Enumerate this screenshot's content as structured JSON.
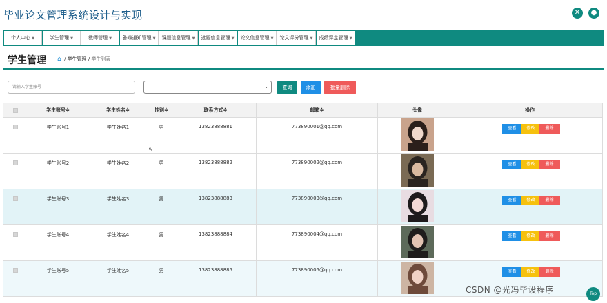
{
  "header": {
    "title": "毕业论文管理系统设计与实现"
  },
  "nav": {
    "items": [
      {
        "label": "个人中心"
      },
      {
        "label": "学生管理"
      },
      {
        "label": "教师管理"
      },
      {
        "label": "答辩通知管理"
      },
      {
        "label": "课题信息管理"
      },
      {
        "label": "选题信息管理"
      },
      {
        "label": "论文信息管理"
      },
      {
        "label": "论文评分管理"
      },
      {
        "label": "成绩评定管理"
      }
    ]
  },
  "page": {
    "title": "学生管理",
    "breadcrumb": {
      "sep": "/",
      "section": "学生管理",
      "current": "学生列表"
    }
  },
  "toolbar": {
    "search_placeholder": "请输入学生账号",
    "select_value": "",
    "query_label": "查询",
    "add_label": "添加",
    "bulk_delete_label": "批量删除"
  },
  "table": {
    "columns": [
      "",
      "学生账号",
      "学生姓名",
      "性别",
      "联系方式",
      "邮箱",
      "头像",
      "操作"
    ],
    "sort_marker": "≑",
    "rows": [
      {
        "account": "学生账号1",
        "name": "学生姓名1",
        "gender": "男",
        "phone": "13823888881",
        "email": "773890001@qq.com",
        "avatar_colors": [
          "#c9a38c",
          "#2b1f1b",
          "#f0d8cc"
        ]
      },
      {
        "account": "学生账号2",
        "name": "学生姓名2",
        "gender": "男",
        "phone": "13823888882",
        "email": "773890002@qq.com",
        "avatar_colors": [
          "#7a6a54",
          "#2a2420",
          "#d9b9a0"
        ]
      },
      {
        "account": "学生账号3",
        "name": "学生姓名3",
        "gender": "男",
        "phone": "13823888883",
        "email": "773890003@qq.com",
        "avatar_colors": [
          "#e8dce2",
          "#1e1a1c",
          "#f3d9d6"
        ]
      },
      {
        "account": "学生账号4",
        "name": "学生姓名4",
        "gender": "男",
        "phone": "13823888884",
        "email": "773890004@qq.com",
        "avatar_colors": [
          "#5d6a5a",
          "#1f1d1c",
          "#e2c3b2"
        ]
      },
      {
        "account": "学生账号5",
        "name": "学生姓名5",
        "gender": "男",
        "phone": "13823888885",
        "email": "773890005@qq.com",
        "avatar_colors": [
          "#cdb5a3",
          "#6e4a3a",
          "#f0d2c5"
        ]
      }
    ],
    "actions": {
      "view": "查看",
      "edit": "修改",
      "delete": "删除"
    }
  },
  "watermark": "CSDN @光冯毕设程序",
  "fab_label": "Top",
  "colors": {
    "primary": "#0f8a80",
    "blue": "#1f8fe6",
    "yellow": "#f6c10e",
    "red": "#ef5a5a"
  }
}
